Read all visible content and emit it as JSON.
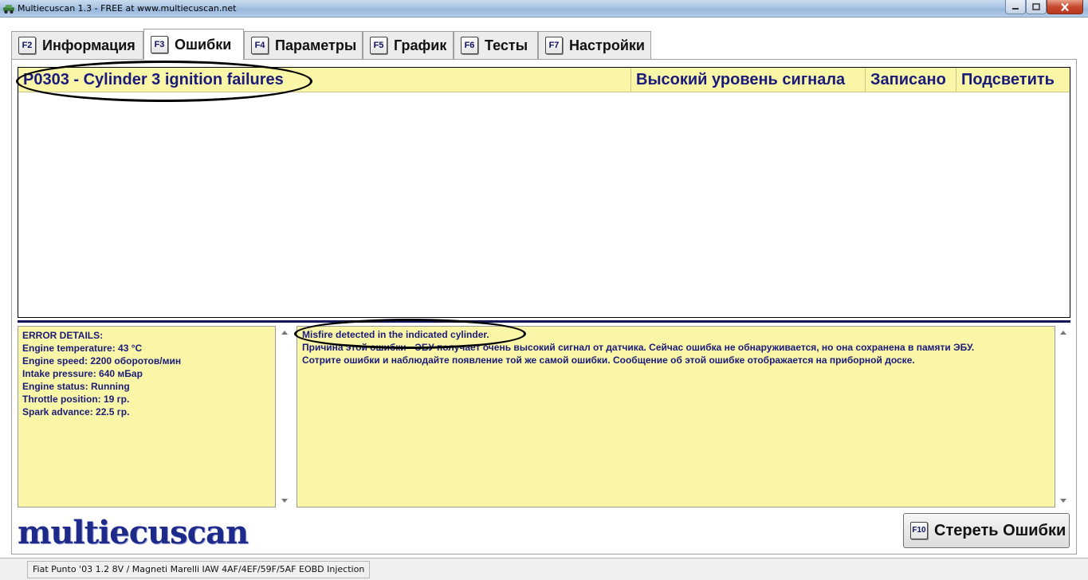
{
  "window": {
    "title": "Multiecuscan 1.3 - FREE at www.multiecuscan.net",
    "icons": {
      "app": "car-icon",
      "minimize": "minimize-icon",
      "maximize": "maximize-icon",
      "close": "close-icon"
    }
  },
  "tabs": [
    {
      "key": "F2",
      "label": "Информация",
      "active": false
    },
    {
      "key": "F3",
      "label": "Ошибки",
      "active": true
    },
    {
      "key": "F4",
      "label": "Параметры",
      "active": false
    },
    {
      "key": "F5",
      "label": "График",
      "active": false
    },
    {
      "key": "F6",
      "label": "Тесты",
      "active": false
    },
    {
      "key": "F7",
      "label": "Настройки",
      "active": false
    }
  ],
  "faults": [
    {
      "code": "P0303 - Cylinder 3 ignition failures",
      "signal": "Высокий уровень сигнала",
      "status": "Записано",
      "action": "Подсветить"
    }
  ],
  "details_left": {
    "lines": [
      "ERROR DETAILS:",
      "Engine temperature: 43 °C",
      "Engine speed: 2200 оборотов/мин",
      "Intake pressure: 640 мБар",
      "Engine status: Running",
      "Throttle position: 19 гр.",
      "Spark advance: 22.5 гр."
    ]
  },
  "details_right": {
    "lines": [
      "Misfire detected in the indicated cylinder.",
      "Причина этой ошибки - ЭБУ получает очень высокий сигнал от датчика. Сейчас ошибка не обнаруживается, но она сохранена в памяти ЭБУ.",
      "Сотрите ошибки и наблюдайте появление той же самой ошибки. Сообщение об этой ошибке отображается на приборной доске."
    ]
  },
  "logo": "multiecuscan",
  "clear_button": {
    "key": "F10",
    "label": "Стереть Ошибки"
  },
  "status": "Fiat Punto '03 1.2 8V / Magneti Marelli IAW 4AF/4EF/59F/5AF EOBD Injection",
  "colors": {
    "panel_yellow": "#faf6a8",
    "text_navy": "#1a1a7a",
    "separator": "#14145a"
  }
}
